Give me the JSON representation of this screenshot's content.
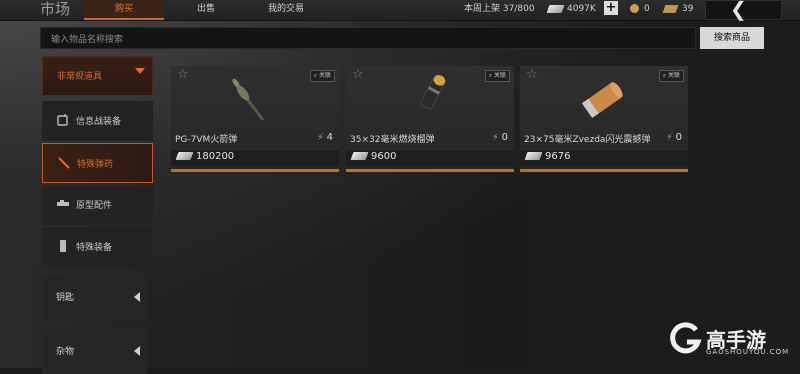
{
  "header": {
    "title": "市场",
    "tabs": [
      {
        "label": "购买",
        "active": true
      },
      {
        "label": "出售",
        "active": false
      },
      {
        "label": "我的交易",
        "active": false
      }
    ],
    "weekly_listing_label": "本周上架",
    "weekly_listing_value": "37/800",
    "money": "4097K",
    "coins": "0",
    "tickets": "39"
  },
  "search": {
    "placeholder": "输入物品名称搜索",
    "button_label": "搜索商品"
  },
  "sidebar": {
    "main_category": "非常规道具",
    "sub_items": [
      {
        "label": "信息战装备",
        "icon": "radio-icon",
        "active": false
      },
      {
        "label": "特殊弹药",
        "icon": "ammo-icon",
        "active": true
      },
      {
        "label": "原型配件",
        "icon": "attachment-icon",
        "active": false
      },
      {
        "label": "特殊装备",
        "icon": "equipment-icon",
        "active": false
      }
    ],
    "collapsed_categories": [
      {
        "label": "钥匙"
      },
      {
        "label": "杂物"
      }
    ]
  },
  "items": [
    {
      "name": "PG-7VM火箭弹",
      "count": "4",
      "price": "180200",
      "related": "关联",
      "art": "rocket"
    },
    {
      "name": "35×32毫米燃烧榴弹",
      "count": "0",
      "price": "9600",
      "related": "关联",
      "art": "grenade"
    },
    {
      "name": "23×75毫米Zvezda闪光震撼弹",
      "count": "0",
      "price": "9676",
      "related": "关联",
      "art": "shell"
    }
  ],
  "watermark": {
    "text": "高手游",
    "sub": "GAOSHOUYOU.COM"
  },
  "colors": {
    "accent": "#e06a2a",
    "card_border": "#b8741e"
  }
}
